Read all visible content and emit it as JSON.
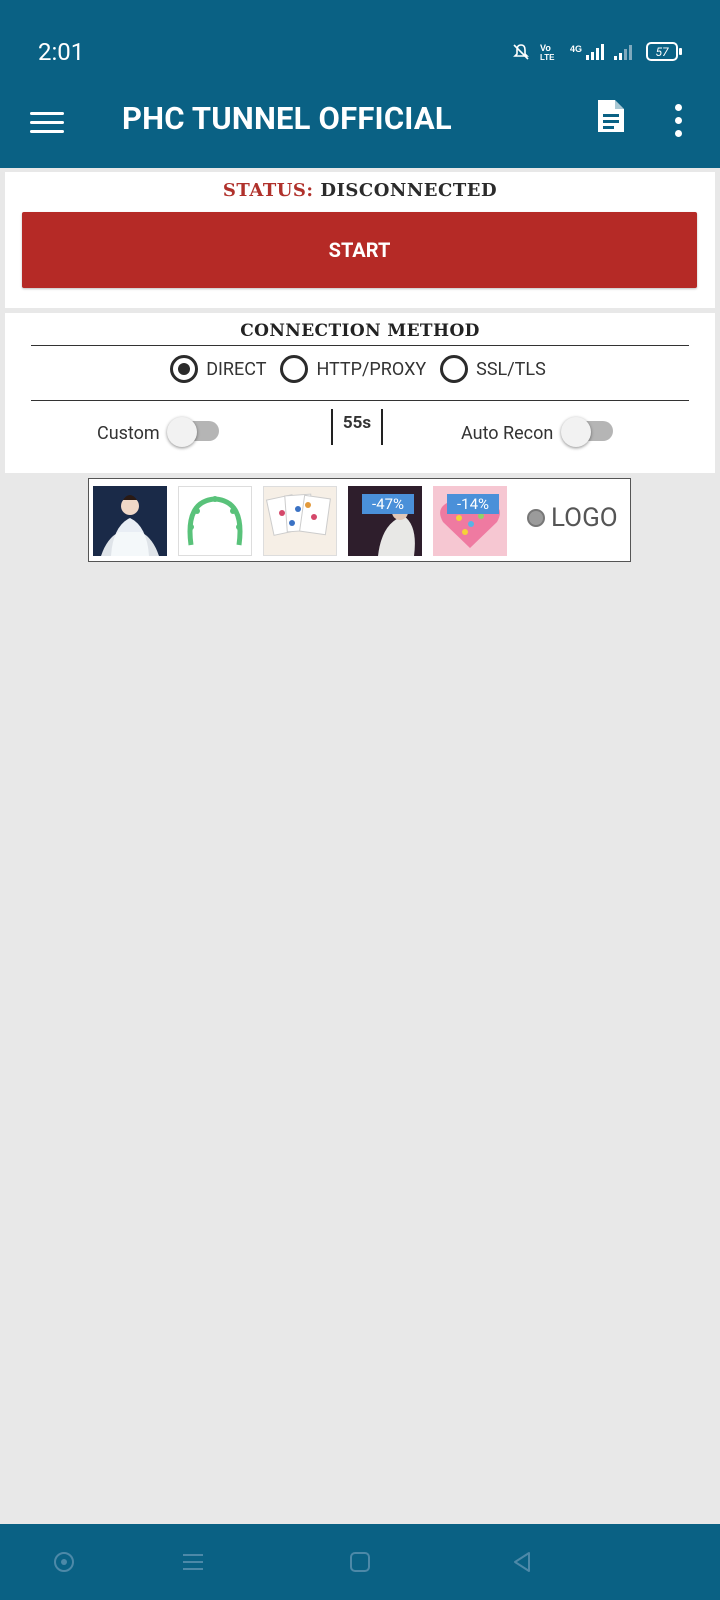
{
  "status_bar": {
    "time": "2:01",
    "battery": "57",
    "icons": [
      "mute-icon",
      "volte-icon",
      "4g-signal-icon",
      "signal-icon",
      "battery-icon"
    ]
  },
  "toolbar": {
    "title": "PHC TUNNEL OFFICIAL",
    "menu_icon": "hamburger-menu-icon",
    "doc_icon": "document-icon",
    "more_icon": "more-vert-icon"
  },
  "status": {
    "key": "STATUS:",
    "value": "DISCONNECTED",
    "start_label": "START"
  },
  "connection": {
    "title": "CONNECTION METHOD",
    "methods": [
      {
        "label": "DIRECT",
        "selected": true
      },
      {
        "label": "HTTP/PROXY",
        "selected": false
      },
      {
        "label": "SSL/TLS",
        "selected": false
      }
    ],
    "custom_label": "Custom",
    "custom_on": false,
    "timer": "55s",
    "autorecon_label": "Auto Recon",
    "autorecon_on": false
  },
  "ad": {
    "badges": [
      "-47%",
      "-14%"
    ],
    "logo": "LOGO"
  },
  "colors": {
    "primary": "#0a6184",
    "start_button": "#b52a26",
    "status_key": "#b0312b",
    "background": "#e8e8e8"
  }
}
